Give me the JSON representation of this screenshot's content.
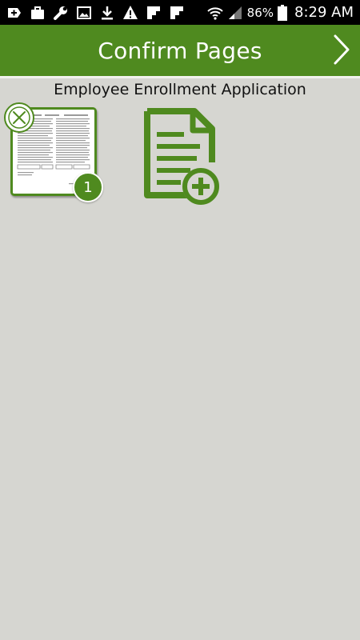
{
  "status_bar": {
    "icons": [
      "add-box-icon",
      "briefcase-icon",
      "wrench-icon",
      "image-icon",
      "download-icon",
      "warning-icon",
      "flipboard-icon",
      "flipboard-icon",
      "wifi-icon",
      "signal-icon",
      "battery-icon"
    ],
    "battery_percent": "86%",
    "time": "8:29 AM"
  },
  "header": {
    "title": "Confirm Pages",
    "next_icon": "chevron-right-icon",
    "color": "#4f8a1f"
  },
  "document": {
    "title": "Employee Enrollment Application",
    "pages": [
      {
        "number": "1",
        "remove_icon": "close-circle-icon"
      }
    ],
    "add_page_icon": "add-document-icon"
  }
}
